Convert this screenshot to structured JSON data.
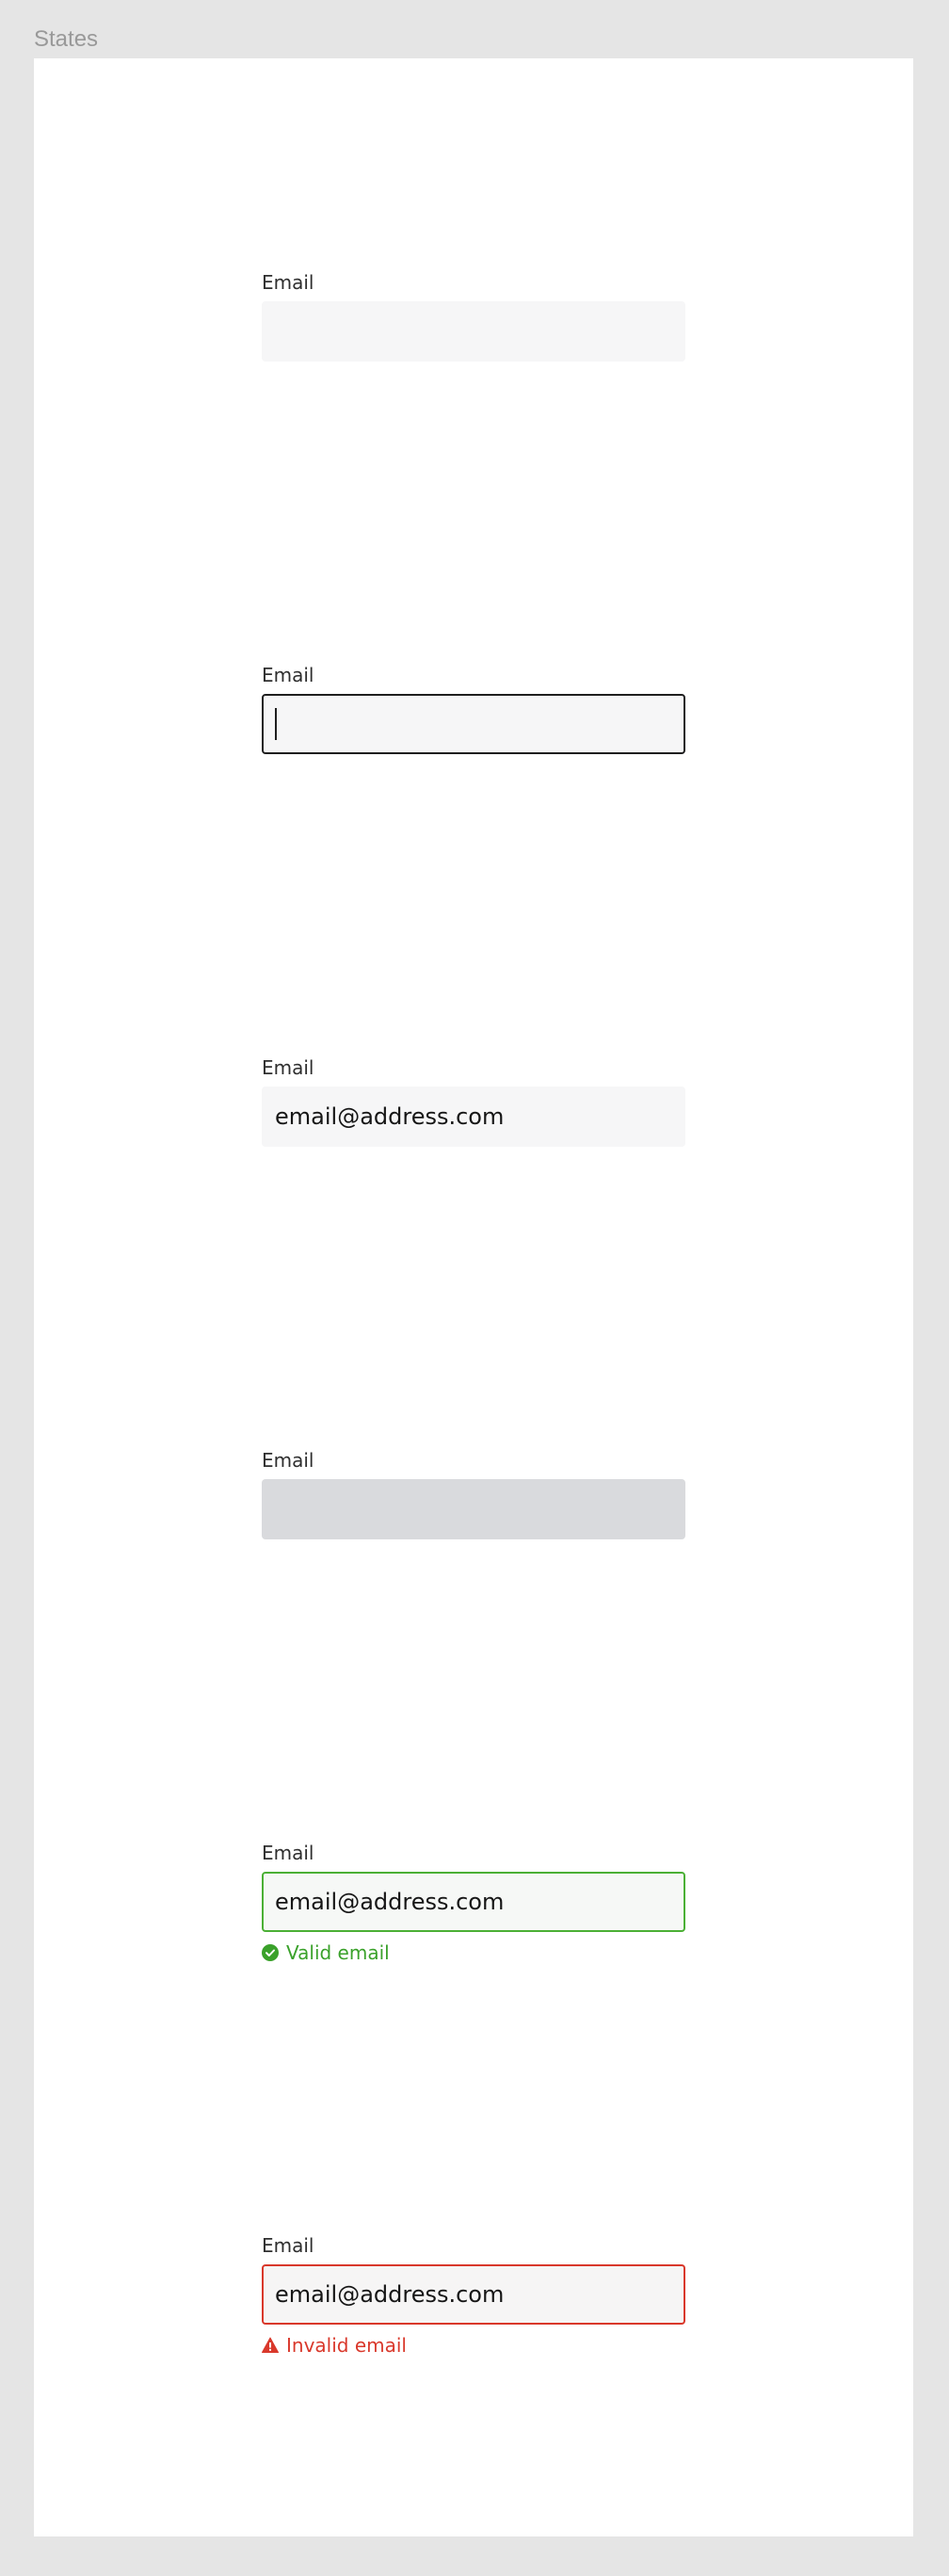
{
  "frame": {
    "title": "States"
  },
  "states": {
    "default": {
      "label": "Email",
      "value": ""
    },
    "focused": {
      "label": "Email",
      "value": ""
    },
    "filled": {
      "label": "Email",
      "value": "email@address.com"
    },
    "disabled": {
      "label": "Email",
      "value": ""
    },
    "success": {
      "label": "Email",
      "value": "email@address.com",
      "helper": "Valid email"
    },
    "error": {
      "label": "Email",
      "value": "email@address.com",
      "helper": "Invalid email"
    }
  },
  "colors": {
    "focus_border": "#1f1f1f",
    "success": "#4bb035",
    "error": "#d9382b",
    "input_background": "#f6f6f7",
    "disabled_background": "#d9dadd"
  },
  "icons": {
    "success": "check-circle-icon",
    "error": "warning-triangle-icon"
  }
}
